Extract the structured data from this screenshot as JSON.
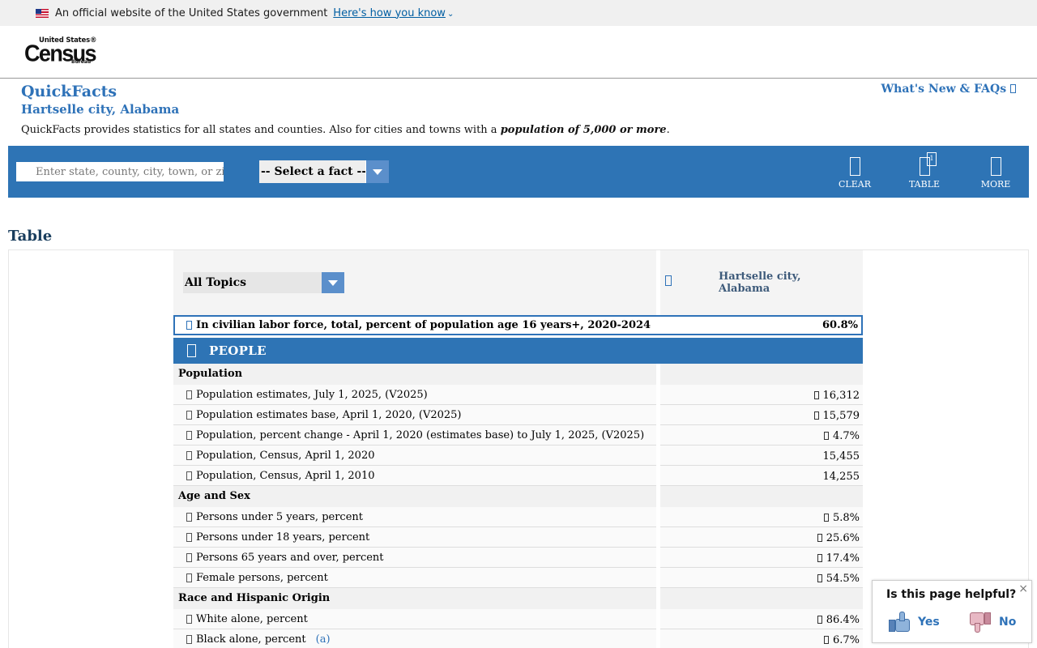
{
  "gov_banner": {
    "text": "An official website of the United States government",
    "link": "Here's how you know"
  },
  "logo": {
    "line1": "United States®",
    "line2": "Census",
    "line3": "Bureau"
  },
  "header": {
    "title": "QuickFacts",
    "subtitle": "Hartselle city, Alabama",
    "description_pre": "QuickFacts provides statistics for all states and counties. Also for cities and towns with a ",
    "description_bold": "population of 5,000 or more",
    "description_post": ".",
    "whats_new": "What's New & FAQs"
  },
  "toolbar": {
    "search_placeholder": "Enter state, county, city, town, or zip code",
    "select_fact": "-- Select a fact --",
    "clear": "CLEAR",
    "table": "TABLE",
    "table_badge": "1",
    "more": "MORE"
  },
  "table_heading": "Table",
  "table": {
    "topics": "All Topics",
    "geography_line1": "Hartselle city,",
    "geography_line2": "Alabama",
    "highlight": {
      "label": "In civilian labor force, total, percent of population age 16 years+, 2020-2024",
      "value": "60.8%"
    },
    "section": "PEOPLE",
    "groups": [
      {
        "category": "Population",
        "rows": [
          {
            "label": "Population estimates, July 1, 2025, (V2025)",
            "value": "16,312",
            "flag": true
          },
          {
            "label": "Population estimates base, April 1, 2020, (V2025)",
            "value": "15,579",
            "flag": true
          },
          {
            "label": "Population, percent change - April 1, 2020 (estimates base) to July 1, 2025, (V2025)",
            "value": "4.7%",
            "flag": true
          },
          {
            "label": "Population, Census, April 1, 2020",
            "value": "15,455",
            "flag": false
          },
          {
            "label": "Population, Census, April 1, 2010",
            "value": "14,255",
            "flag": false
          }
        ]
      },
      {
        "category": "Age and Sex",
        "rows": [
          {
            "label": "Persons under 5 years, percent",
            "value": "5.8%",
            "flag": true
          },
          {
            "label": "Persons under 18 years, percent",
            "value": "25.6%",
            "flag": true
          },
          {
            "label": "Persons 65 years and over, percent",
            "value": "17.4%",
            "flag": true
          },
          {
            "label": "Female persons, percent",
            "value": "54.5%",
            "flag": true
          }
        ]
      },
      {
        "category": "Race and Hispanic Origin",
        "rows": [
          {
            "label": "White alone, percent",
            "value": "86.4%",
            "flag": true
          },
          {
            "label": "Black alone, percent",
            "note": "(a)",
            "value": "6.7%",
            "flag": true
          }
        ]
      }
    ]
  },
  "feedback": {
    "question": "Is this page helpful?",
    "yes": "Yes",
    "no": "No",
    "close": "×"
  }
}
